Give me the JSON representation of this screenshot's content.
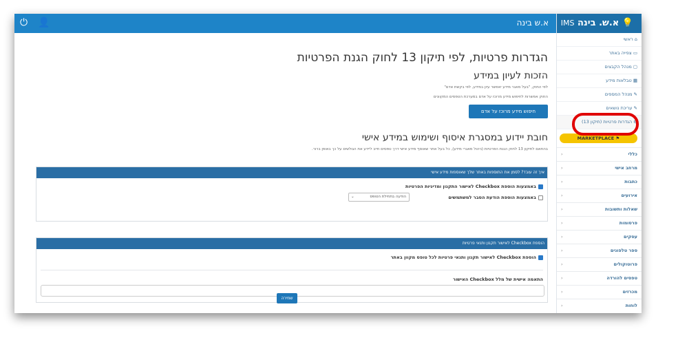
{
  "window": {
    "title": "א.ש בינה"
  },
  "brand": {
    "name": "א.ש. בינה",
    "suffix": "IMS"
  },
  "sidebar": {
    "nav": [
      {
        "label": "ראשי",
        "icon": "home-icon"
      },
      {
        "label": "צפייה באתר",
        "icon": "monitor-icon"
      },
      {
        "label": "מנהל הקבצים",
        "icon": "folder-icon"
      },
      {
        "label": "טבלאות מידע",
        "icon": "table-icon"
      },
      {
        "label": "מנהל המספים",
        "icon": "edit-icon"
      },
      {
        "label": "עריכת נושאים",
        "icon": "edit-icon"
      },
      {
        "label": "הגדרות פרטיות (תיקון 13)",
        "icon": "gear-icon"
      }
    ],
    "marketplace": "MARKETPLACE",
    "menu": [
      "כללי",
      "מרחב אישי",
      "כתבות",
      "אירועים",
      "שאלות ותשובות",
      "פרסומות",
      "עסקים",
      "ספר טלפונים",
      "פרוטוקולים",
      "טפסים להורדה",
      "מכרזים",
      "לוחות"
    ],
    "chevron": "›"
  },
  "page": {
    "title": "הגדרות פרטיות, לפי תיקון 13 לחוק הגנת הפרטיות",
    "section1_title": "הזכות לעיון במידע",
    "section1_line1": "לפי החוק, \"בעל מאגר מידע יאפשר עיון במידע, לפי בקשת אדם\"",
    "section1_line2": "החוק אפשרות לחיפוש מידע מרוכז על אדם במערכת הטפסים המקוונים",
    "search_button": "חיפוש מידע מרוכז על אדם",
    "section2_title": "חובת יידוע במסגרת איסוף ושימוש במידע אישי",
    "section2_text": "בהתאם לתיקון 13 לחוק הגנת הפרטיות (ניהול מאגרי מידע), כל בעל אתר שאוסף מידע אישי דרך טפסים חייב ליידע את הגולשים על כך באופן ברור.",
    "panel1": {
      "header": "איך זה עובד? לסמן את התוספות באתר שלך שאוספות מידע אישי",
      "opt1": "באמצעות הוספת Checkbox לאישור התקנון ומדיניות הפרטיות",
      "opt2": "באמצעות הוספת הודעת הסבר למשתמשים",
      "select_value": "הודעה בתחילת הטופס"
    },
    "panel2": {
      "header": "הוספת Checkbox לאישור תקנון ותנאי פרטיות",
      "opt1": "הוספת Checkbox לאישור תקנון ותנאי פרטיות לכל טופס מקוון באתר",
      "field_label": "התאמה אישית של מלל Checkbox האישור",
      "field_value": ""
    },
    "save_button": "שמירה"
  }
}
